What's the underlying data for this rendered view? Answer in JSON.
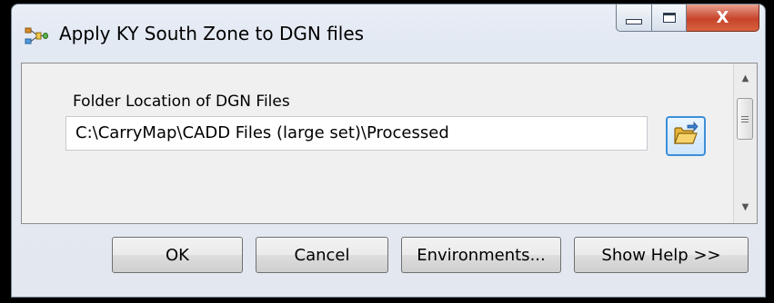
{
  "window": {
    "title": "Apply KY South Zone to DGN files",
    "icon": "model-builder-tool-icon",
    "caption": {
      "minimize_icon": "minimize-icon",
      "maximize_icon": "maximize-icon",
      "close_label": "X"
    }
  },
  "form": {
    "folder_label": "Folder Location of DGN Files",
    "folder_value": "C:\\CarryMap\\CADD Files (large set)\\Processed",
    "browse_icon": "open-folder-icon"
  },
  "buttons": {
    "ok": "OK",
    "cancel": "Cancel",
    "environments": "Environments...",
    "show_help": "Show Help >>"
  },
  "colors": {
    "window_bg": "#e3e9f3",
    "close_button": "#c7432a",
    "browse_border": "#3c8fd6"
  }
}
